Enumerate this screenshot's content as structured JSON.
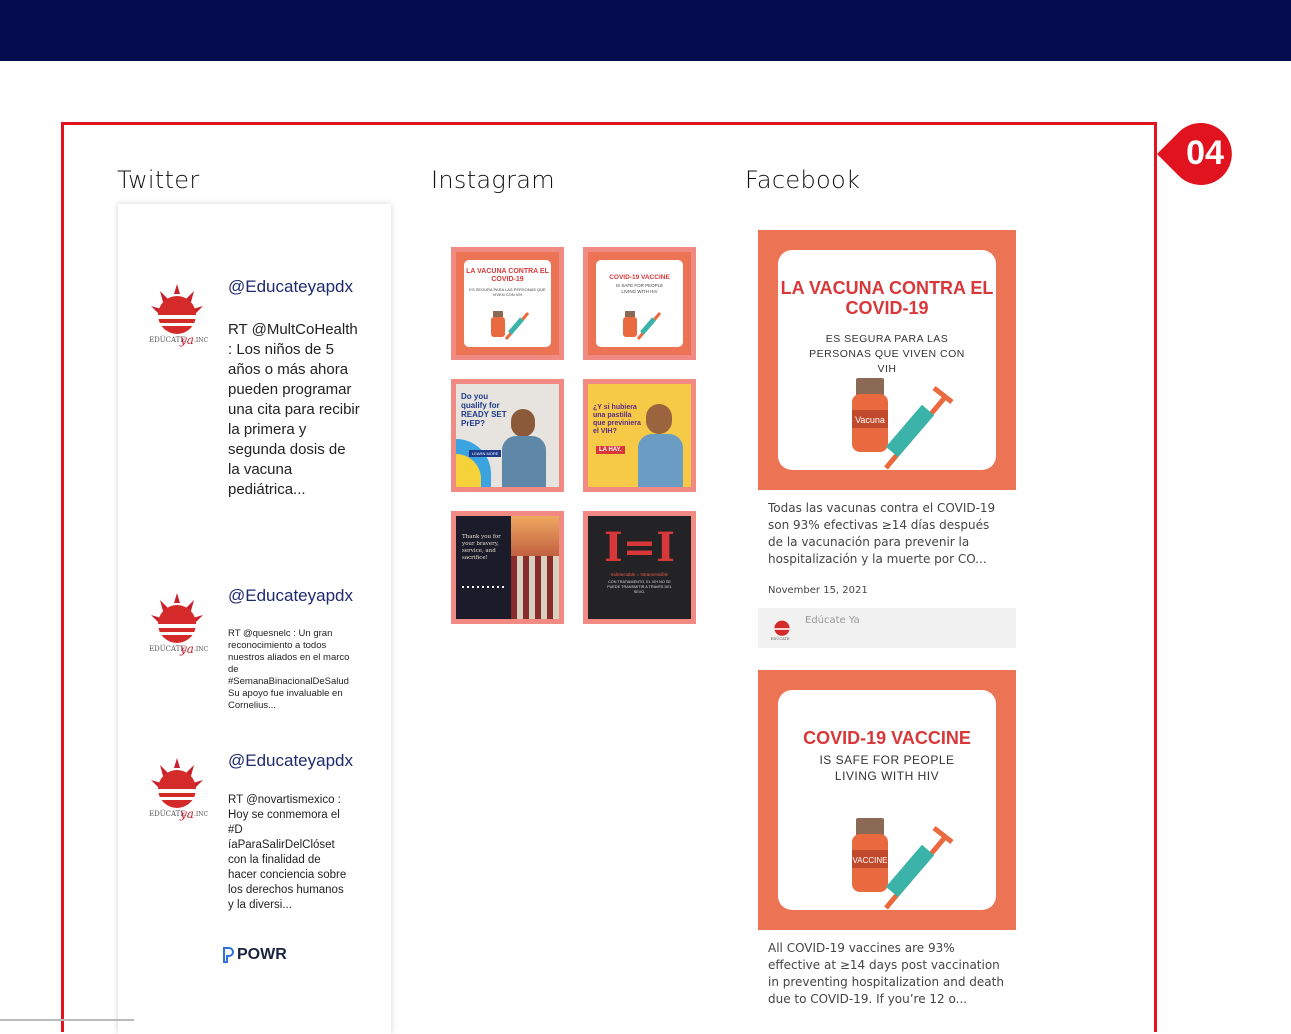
{
  "badge": "04",
  "columns": {
    "twitter": "Twitter",
    "instagram": "Instagram",
    "facebook": "Facebook"
  },
  "tweets": [
    {
      "handle": "@Educateyapdx",
      "text": "RT @MultCoHealth : Los niños de 5 años o más ahora pueden programar una cita para recibir la primera y segunda dosis de la vacuna pediátrica..."
    },
    {
      "handle": "@Educateyapdx",
      "text": "RT @quesnelc : Un gran reconocimiento a todos nuestros aliados en el marco de #SemanaBinacionalDeSalud Su apoyo fue invaluable en Cornelius..."
    },
    {
      "handle": "@Educateyapdx",
      "text": "RT @novartismexico : Hoy se conmemora el #D íaParaSalirDelClóset con la finalidad de hacer conciencia sobre los derechos humanos y la diversi..."
    }
  ],
  "powr": "POWR",
  "instagram": {
    "tile1": {
      "title": "LA VACUNA CONTRA EL COVID-19",
      "sub": "ES SEGURA PARA LAS PERSONAS QUE VIVEN CON VIH"
    },
    "tile2": {
      "title": "COVID-19 VACCINE",
      "sub": "IS SAFE FOR PEOPLE LIVING WITH HIV"
    },
    "tile3": {
      "title": "Do you qualify for READY SET PrEP?",
      "cta": "LEARN MORE"
    },
    "tile4": {
      "title": "¿Y si hubiera una pastilla que previniera el VIH?",
      "cta": "LA HAY."
    },
    "tile5": {
      "title": "Thank you for your bravery, service, and sacrifice!"
    },
    "tile6": {
      "title": "I=I",
      "sub": "Indetectable = Intransmisible",
      "body": "CON TRATAMIENTO, EL VIH NO SE PUEDE TRANSMITIR A TRAVÉS DEL SEXO."
    }
  },
  "facebook": {
    "post1": {
      "title": "LA VACUNA CONTRA EL COVID-19",
      "sub": "ES SEGURA PARA LAS PERSONAS QUE VIVEN CON VIH",
      "vial_label": "Vacuna",
      "text": "Todas las vacunas contra el COVID-19 son 93% efectivas ≥14 días después de la vacunación para prevenir la hospitalización y la muerte por CO...",
      "date": "November 15, 2021",
      "author": "Edúcate Ya"
    },
    "post2": {
      "title": "COVID-19 VACCINE",
      "sub": "IS SAFE FOR PEOPLE LIVING WITH HIV",
      "vial_label": "VACCINE",
      "text": "All COVID-19 vaccines are 93% effective at ≥14 days post vaccination in preventing hospitalization and death due to COVID-19. If you’re 12 o..."
    }
  },
  "colors": {
    "navy": "#050c50",
    "red": "#e0131f",
    "coral": "#ec7455",
    "ig_border": "#f08a82"
  }
}
